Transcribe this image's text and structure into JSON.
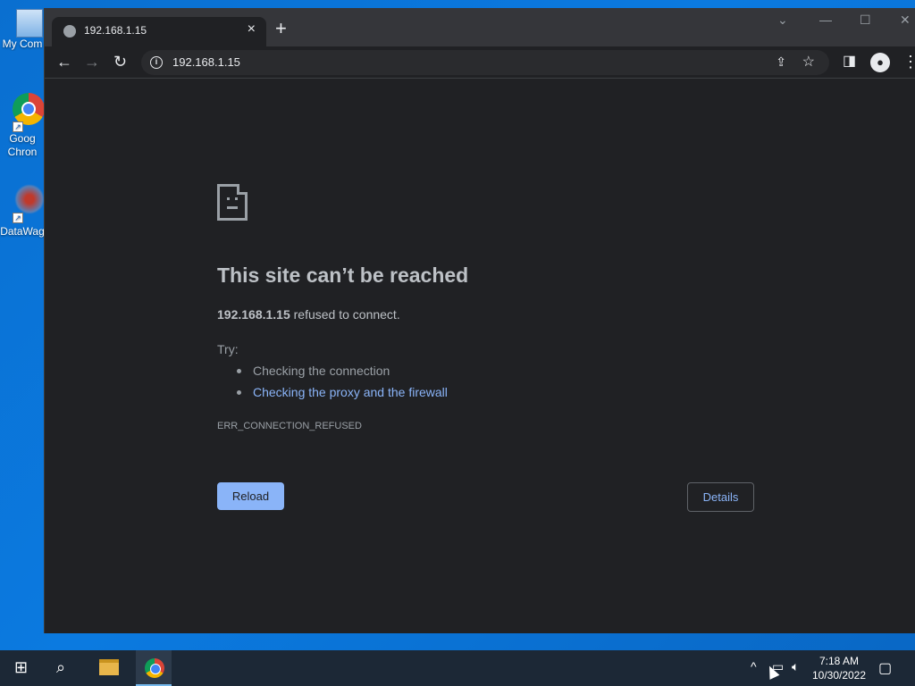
{
  "desktop": {
    "icons": [
      {
        "label": "My Com",
        "icon": "computer-icon"
      },
      {
        "label": "Goog\nChron",
        "line1": "Goog",
        "line2": "Chron",
        "icon": "chrome-icon"
      },
      {
        "label": "DataWag",
        "icon": "datawag-icon"
      }
    ]
  },
  "browser": {
    "tab": {
      "title": "192.168.1.15",
      "icon": "globe-icon"
    },
    "address": {
      "url": "192.168.1.15"
    }
  },
  "error_page": {
    "heading": "This site can’t be reached",
    "host": "192.168.1.15",
    "message_suffix": " refused to connect.",
    "try_label": "Try:",
    "suggestions": [
      "Checking the connection",
      "Checking the proxy and the firewall"
    ],
    "error_code": "ERR_CONNECTION_REFUSED",
    "reload_label": "Reload",
    "details_label": "Details"
  },
  "taskbar": {
    "time": "7:18 AM",
    "date": "10/30/2022"
  },
  "colors": {
    "page_bg": "#202124",
    "link": "#8ab4f8",
    "button_primary": "#8ab4f8"
  }
}
